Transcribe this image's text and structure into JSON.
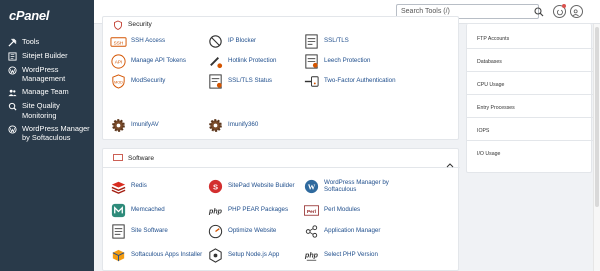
{
  "brand": {
    "logo": "cPanel"
  },
  "sidebar": {
    "items": [
      {
        "label": "Tools",
        "icon": "tools-icon"
      },
      {
        "label": "Sitejet Builder",
        "icon": "sitejet-icon"
      },
      {
        "label": "WordPress Management",
        "icon": "wordpress-icon"
      },
      {
        "label": "Manage Team",
        "icon": "team-icon"
      },
      {
        "label": "Site Quality Monitoring",
        "icon": "monitoring-icon"
      },
      {
        "label": "WordPress Manager by Softaculous",
        "icon": "wordpress-icon"
      }
    ]
  },
  "header": {
    "search_placeholder": "Search Tools (/)"
  },
  "security": {
    "title": "Security",
    "items": [
      {
        "label": "SSH Access",
        "icon": "ssh-icon"
      },
      {
        "label": "IP Blocker",
        "icon": "ip-blocker-icon"
      },
      {
        "label": "SSL/TLS",
        "icon": "ssl-icon"
      },
      {
        "label": "Manage API Tokens",
        "icon": "api-icon"
      },
      {
        "label": "Hotlink Protection",
        "icon": "hotlink-icon"
      },
      {
        "label": "Leech Protection",
        "icon": "leech-icon"
      },
      {
        "label": "ModSecurity",
        "icon": "modsecurity-icon"
      },
      {
        "label": "SSL/TLS Status",
        "icon": "ssl-status-icon"
      },
      {
        "label": "Two-Factor Authentication",
        "icon": "two-factor-icon"
      },
      {
        "label": "ImunifyAV",
        "icon": "gear-icon"
      },
      {
        "label": "Imunify360",
        "icon": "gear-icon"
      }
    ]
  },
  "software": {
    "title": "Software",
    "items": [
      {
        "label": "Redis",
        "icon": "redis-icon"
      },
      {
        "label": "SitePad Website Builder",
        "icon": "sitepad-icon"
      },
      {
        "label": "WordPress Manager by Softaculous",
        "icon": "wordpress-icon"
      },
      {
        "label": "Memcached",
        "icon": "memcached-icon"
      },
      {
        "label": "PHP PEAR Packages",
        "icon": "php-icon"
      },
      {
        "label": "Perl Modules",
        "icon": "perl-icon"
      },
      {
        "label": "Site Software",
        "icon": "site-software-icon"
      },
      {
        "label": "Optimize Website",
        "icon": "optimize-icon"
      },
      {
        "label": "Application Manager",
        "icon": "application-manager-icon"
      },
      {
        "label": "Softaculous Apps Installer",
        "icon": "softaculous-icon"
      },
      {
        "label": "Setup Node.js App",
        "icon": "nodejs-icon"
      },
      {
        "label": "Select PHP Version",
        "icon": "php-icon"
      }
    ]
  },
  "stats": [
    "FTP Accounts",
    "Databases",
    "CPU Usage",
    "Entry Processes",
    "IOPS",
    "I/O Usage"
  ]
}
